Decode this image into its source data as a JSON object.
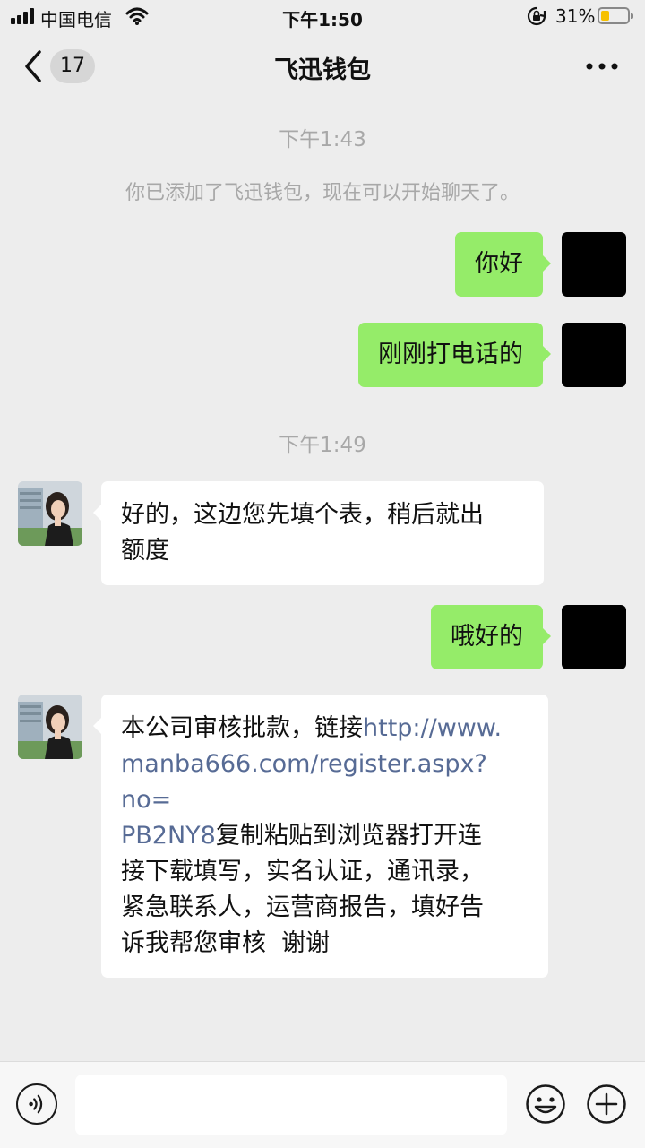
{
  "status_bar": {
    "carrier": "中国电信",
    "time": "下午1:50",
    "battery_percent": "31%",
    "battery_level": 0.31,
    "icons": [
      "signal-icon",
      "wifi-icon",
      "rotation-lock-icon",
      "battery-icon"
    ]
  },
  "nav": {
    "unread_count": "17",
    "title": "飞迅钱包",
    "icons": [
      "back-chevron-icon",
      "more-icon"
    ]
  },
  "chat": {
    "timestamp_1": "下午1:43",
    "system_message": "你已添加了飞迅钱包，现在可以开始聊天了。",
    "msg_1": "你好",
    "msg_2": "刚刚打电话的",
    "timestamp_2": "下午1:49",
    "msg_3_line1": "好的，这边您先填个表，稍后就出",
    "msg_3_line2": "额度",
    "msg_4": "哦好的",
    "msg_5": {
      "line1_text": "本公司审核批款，链接",
      "line1_link": "http://www.",
      "line2_link": "manba666.com/register.aspx?no=",
      "line3_link": "PB2NY8",
      "line3_text": "复制粘贴到浏览器打开连",
      "line4": "接下载填写，实名认证，通讯录，",
      "line5": "紧急联系人，运营商报告，填好告",
      "line6": "诉我帮您审核  谢谢"
    },
    "colors": {
      "my_bubble": "#95ec69",
      "their_bubble": "#ffffff",
      "link": "#576b95",
      "background": "#ededed"
    }
  },
  "input_bar": {
    "input_value": "",
    "icons": [
      "voice-icon",
      "emoji-icon",
      "plus-icon"
    ]
  }
}
